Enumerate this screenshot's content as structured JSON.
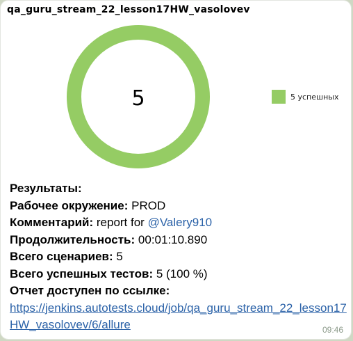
{
  "message": {
    "title": "qa_guru_stream_22_lesson17HW_vasolovev",
    "time": "09:46"
  },
  "chart_data": {
    "type": "pie",
    "center_label": "5",
    "slices": [
      {
        "label": "5 успешных",
        "value": 5,
        "color": "#95cc64"
      }
    ],
    "legend_position": "right"
  },
  "results": {
    "heading": "Результаты:",
    "env_label": "Рабочее окружение:",
    "env_value": "PROD",
    "comment_label": "Комментарий:",
    "comment_text": "report for",
    "comment_mention": "@Valery910",
    "duration_label": "Продолжительность:",
    "duration_value": "00:01:10.890",
    "scenarios_label": "Всего сценариев:",
    "scenarios_value": "5",
    "passed_label": "Всего успешных тестов:",
    "passed_value": "5 (100 %)",
    "report_label": "Отчет доступен по ссылке:",
    "report_url": "https://jenkins.autotests.cloud/job/qa_guru_stream_22_lesson17HW_vasolovev/6/allure"
  }
}
